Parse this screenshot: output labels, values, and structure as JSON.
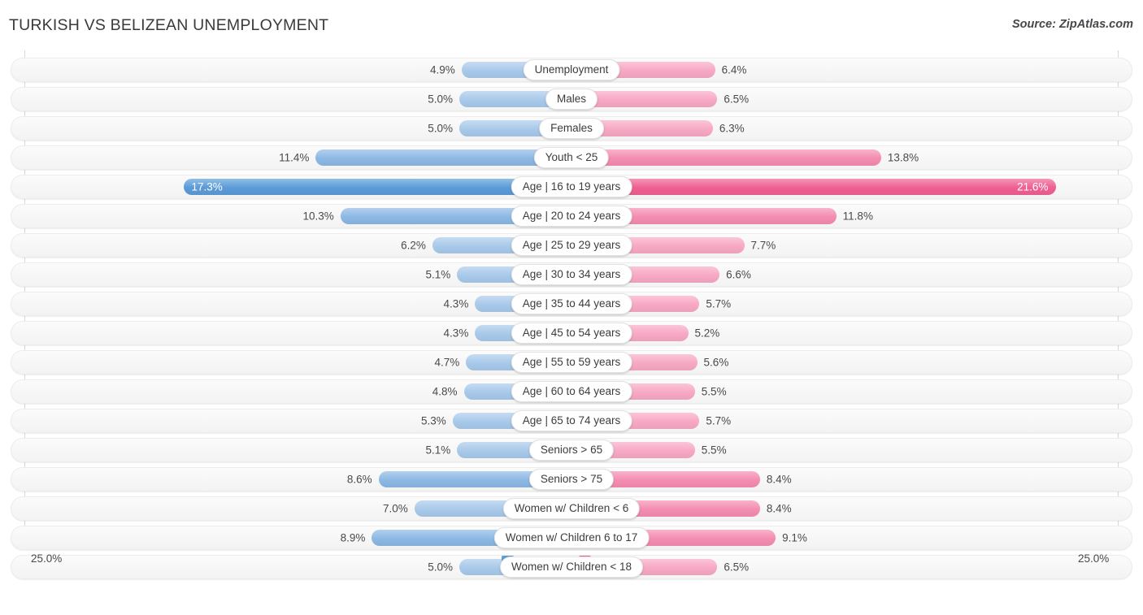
{
  "header": {
    "title": "TURKISH VS BELIZEAN UNEMPLOYMENT",
    "source": "Source: ZipAtlas.com"
  },
  "axis": {
    "left_label": "25.0%",
    "right_label": "25.0%",
    "max": 25.0
  },
  "legend": {
    "items": [
      {
        "label": "Turkish",
        "color": "#5b9bd8"
      },
      {
        "label": "Belizean",
        "color": "#ef5f92"
      }
    ]
  },
  "colors": {
    "left_light": "#a8c9ea",
    "left_mid": "#8cb8e4",
    "left_dark": "#5b9bd8",
    "right_light": "#f7a8c4",
    "right_mid": "#f48cb1",
    "right_dark": "#ef5f92",
    "track": "#f5f5f5",
    "axis": "#d8d8d8"
  },
  "chart_data": {
    "type": "bar",
    "title": "TURKISH VS BELIZEAN UNEMPLOYMENT",
    "subtitle": "",
    "xlabel": "",
    "ylabel": "",
    "orientation": "horizontal-diverging",
    "xlim": [
      0,
      25.0
    ],
    "grid": false,
    "legend_position": "bottom-center",
    "categories": [
      "Unemployment",
      "Males",
      "Females",
      "Youth < 25",
      "Age | 16 to 19 years",
      "Age | 20 to 24 years",
      "Age | 25 to 29 years",
      "Age | 30 to 34 years",
      "Age | 35 to 44 years",
      "Age | 45 to 54 years",
      "Age | 55 to 59 years",
      "Age | 60 to 64 years",
      "Age | 65 to 74 years",
      "Seniors > 65",
      "Seniors > 75",
      "Women w/ Children < 6",
      "Women w/ Children 6 to 17",
      "Women w/ Children < 18"
    ],
    "series": [
      {
        "name": "Turkish",
        "side": "left",
        "values": [
          4.9,
          5.0,
          5.0,
          11.4,
          17.3,
          10.3,
          6.2,
          5.1,
          4.3,
          4.3,
          4.7,
          4.8,
          5.3,
          5.1,
          8.6,
          7.0,
          8.9,
          5.0
        ],
        "labels": [
          "4.9%",
          "5.0%",
          "5.0%",
          "11.4%",
          "17.3%",
          "10.3%",
          "6.2%",
          "5.1%",
          "4.3%",
          "4.3%",
          "4.7%",
          "4.8%",
          "5.3%",
          "5.1%",
          "8.6%",
          "7.0%",
          "8.9%",
          "5.0%"
        ]
      },
      {
        "name": "Belizean",
        "side": "right",
        "values": [
          6.4,
          6.5,
          6.3,
          13.8,
          21.6,
          11.8,
          7.7,
          6.6,
          5.7,
          5.2,
          5.6,
          5.5,
          5.7,
          5.5,
          8.4,
          8.4,
          9.1,
          6.5
        ],
        "labels": [
          "6.4%",
          "6.5%",
          "6.3%",
          "13.8%",
          "21.6%",
          "11.8%",
          "7.7%",
          "6.6%",
          "5.7%",
          "5.2%",
          "5.6%",
          "5.5%",
          "5.7%",
          "5.5%",
          "8.4%",
          "8.4%",
          "9.1%",
          "6.5%"
        ]
      }
    ],
    "rows": [
      {
        "label": "Unemployment",
        "left": 4.9,
        "left_label": "4.9%",
        "right": 6.4,
        "right_label": "6.4%",
        "highlight": false
      },
      {
        "label": "Males",
        "left": 5.0,
        "left_label": "5.0%",
        "right": 6.5,
        "right_label": "6.5%",
        "highlight": false
      },
      {
        "label": "Females",
        "left": 5.0,
        "left_label": "5.0%",
        "right": 6.3,
        "right_label": "6.3%",
        "highlight": false
      },
      {
        "label": "Youth < 25",
        "left": 11.4,
        "left_label": "11.4%",
        "right": 13.8,
        "right_label": "13.8%",
        "highlight": false
      },
      {
        "label": "Age | 16 to 19 years",
        "left": 17.3,
        "left_label": "17.3%",
        "right": 21.6,
        "right_label": "21.6%",
        "highlight": true
      },
      {
        "label": "Age | 20 to 24 years",
        "left": 10.3,
        "left_label": "10.3%",
        "right": 11.8,
        "right_label": "11.8%",
        "highlight": false
      },
      {
        "label": "Age | 25 to 29 years",
        "left": 6.2,
        "left_label": "6.2%",
        "right": 7.7,
        "right_label": "7.7%",
        "highlight": false
      },
      {
        "label": "Age | 30 to 34 years",
        "left": 5.1,
        "left_label": "5.1%",
        "right": 6.6,
        "right_label": "6.6%",
        "highlight": false
      },
      {
        "label": "Age | 35 to 44 years",
        "left": 4.3,
        "left_label": "4.3%",
        "right": 5.7,
        "right_label": "5.7%",
        "highlight": false
      },
      {
        "label": "Age | 45 to 54 years",
        "left": 4.3,
        "left_label": "4.3%",
        "right": 5.2,
        "right_label": "5.2%",
        "highlight": false
      },
      {
        "label": "Age | 55 to 59 years",
        "left": 4.7,
        "left_label": "4.7%",
        "right": 5.6,
        "right_label": "5.6%",
        "highlight": false
      },
      {
        "label": "Age | 60 to 64 years",
        "left": 4.8,
        "left_label": "4.8%",
        "right": 5.5,
        "right_label": "5.5%",
        "highlight": false
      },
      {
        "label": "Age | 65 to 74 years",
        "left": 5.3,
        "left_label": "5.3%",
        "right": 5.7,
        "right_label": "5.7%",
        "highlight": false
      },
      {
        "label": "Seniors > 65",
        "left": 5.1,
        "left_label": "5.1%",
        "right": 5.5,
        "right_label": "5.5%",
        "highlight": false
      },
      {
        "label": "Seniors > 75",
        "left": 8.6,
        "left_label": "8.6%",
        "right": 8.4,
        "right_label": "8.4%",
        "highlight": false
      },
      {
        "label": "Women w/ Children < 6",
        "left": 7.0,
        "left_label": "7.0%",
        "right": 8.4,
        "right_label": "8.4%",
        "highlight": false
      },
      {
        "label": "Women w/ Children 6 to 17",
        "left": 8.9,
        "left_label": "8.9%",
        "right": 9.1,
        "right_label": "9.1%",
        "highlight": false
      },
      {
        "label": "Women w/ Children < 18",
        "left": 5.0,
        "left_label": "5.0%",
        "right": 6.5,
        "right_label": "6.5%",
        "highlight": false
      }
    ]
  }
}
